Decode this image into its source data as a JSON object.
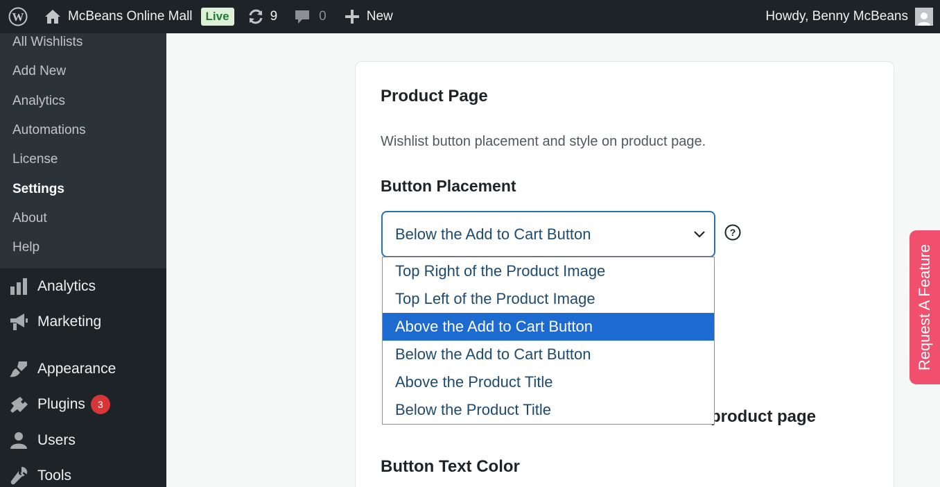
{
  "adminbar": {
    "site_name": "McBeans Online Mall",
    "live_badge": "Live",
    "updates_count": "9",
    "comments_count": "0",
    "new_label": "New",
    "howdy": "Howdy, Benny McBeans"
  },
  "sidebar": {
    "submenu": [
      "All Wishlists",
      "Add New",
      "Analytics",
      "Automations",
      "License",
      "Settings",
      "About",
      "Help"
    ],
    "current_submenu": "Settings",
    "menu": [
      {
        "label": "Analytics",
        "icon": "bar-chart-icon"
      },
      {
        "label": "Marketing",
        "icon": "megaphone-icon"
      },
      {
        "label": "Appearance",
        "icon": "paintbrush-icon"
      },
      {
        "label": "Plugins",
        "icon": "plugin-icon",
        "badge": "3"
      },
      {
        "label": "Users",
        "icon": "users-icon"
      },
      {
        "label": "Tools",
        "icon": "wrench-icon"
      }
    ]
  },
  "main": {
    "section_title": "Product Page",
    "section_desc": "Wishlist button placement and style on product page.",
    "placement_label": "Button Placement",
    "placement_value": "Below the Add to Cart Button",
    "dropdown_options": [
      "Top Right of the Product Image",
      "Top Left of the Product Image",
      "Above the Add to Cart Button",
      "Below the Add to Cart Button",
      "Above the Product Title",
      "Below the Product Title"
    ],
    "highlighted_option": "Above the Add to Cart Button",
    "partially_hidden_heading": "product page",
    "text_color_label": "Button Text Color"
  },
  "feature_tab": "Request A Feature",
  "colors": {
    "adminbar_bg": "#1d2327",
    "submenu_bg": "#2c3338",
    "accent": "#2271b1",
    "highlight": "#1d6ad1",
    "feature_tab": "#f0506e",
    "badge": "#d63638"
  }
}
